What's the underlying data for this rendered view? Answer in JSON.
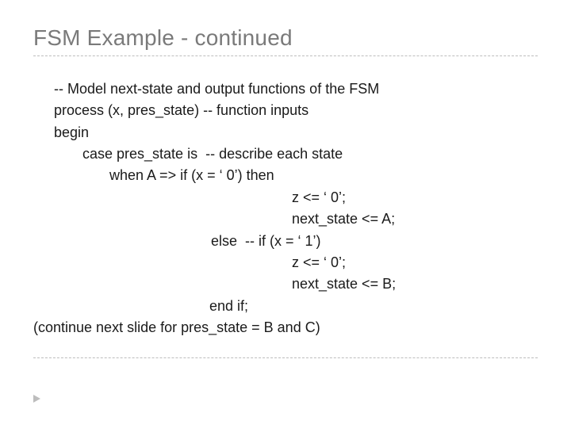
{
  "title": "FSM Example - continued",
  "code": {
    "l1": "-- Model next-state and output functions of the FSM",
    "l2": "process (x, pres_state) -- function inputs",
    "l3": "begin",
    "l4": "case pres_state is  -- describe each state",
    "l5": "when A => if (x = ‘ 0’) then",
    "l6": "z <= ‘ 0’;",
    "l7": "next_state <= A;",
    "l8": "else  -- if (x = ‘ 1’)",
    "l9": "z <= ‘ 0’;",
    "l10": "next_state <= B;",
    "l11": "end if;",
    "l12": "(continue next slide for pres_state = B and C)"
  }
}
